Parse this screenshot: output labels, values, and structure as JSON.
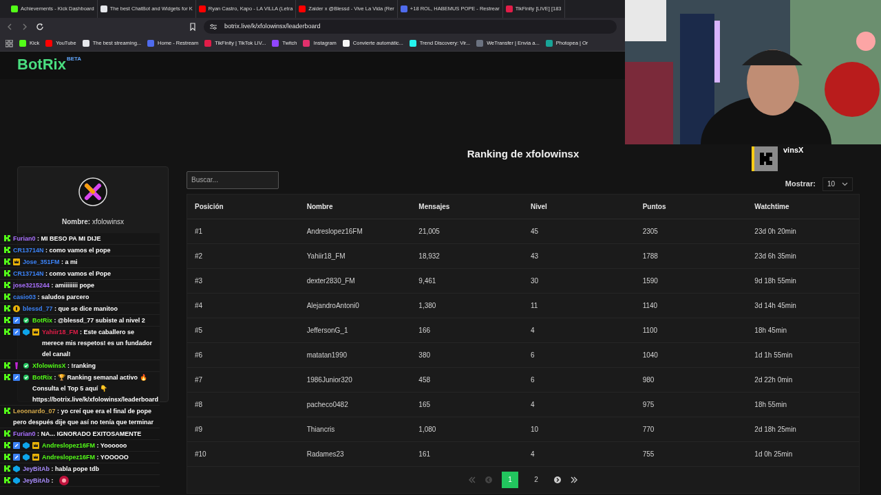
{
  "browser": {
    "tabs": [
      {
        "title": "Achievements - Kick Dashboard",
        "color": "#53fc18"
      },
      {
        "title": "The best ChatBot and Widgets for K",
        "color": "#e5e7eb"
      },
      {
        "title": "Ryan Castro, Kapo - LA VILLA (Letra",
        "color": "#ff0000"
      },
      {
        "title": "Zaider x @Blessd - Vive La Vida (Rer",
        "color": "#ff0000"
      },
      {
        "title": "+18 ROL, HABEMUS POPE - Restrear",
        "color": "#4f6bed"
      },
      {
        "title": "TikFinity [LIVE] [183",
        "color": "#e11d48"
      }
    ],
    "url": "botrix.live/k/xfolowinsx/leaderboard",
    "bookmarks": [
      {
        "label": "Kick",
        "color": "#53fc18"
      },
      {
        "label": "YouTube",
        "color": "#ff0000"
      },
      {
        "label": "The best streaming...",
        "color": "#e5e7eb"
      },
      {
        "label": "Home - Restream",
        "color": "#4f6bed"
      },
      {
        "label": "TikFinity | TikTok LIV...",
        "color": "#e11d48"
      },
      {
        "label": "Twitch",
        "color": "#9146ff"
      },
      {
        "label": "Instagram",
        "color": "#e1306c"
      },
      {
        "label": "Convierte automátic...",
        "color": "#f5f5f5"
      },
      {
        "label": "Trend Discovery: Vir...",
        "color": "#25f4ee"
      },
      {
        "label": "WeTransfer | Envía a...",
        "color": "#6b7280"
      },
      {
        "label": "Photopea | Or",
        "color": "#18a497"
      }
    ]
  },
  "header": {
    "logo": "BotRix",
    "badge": "BETA"
  },
  "profile": {
    "name_label": "Nombre:",
    "name": "xfolowinsx"
  },
  "ranking": {
    "title": "Ranking de xfolowinsx",
    "search_placeholder": "Buscar...",
    "show_label": "Mostrar:",
    "show_value": "10",
    "columns": [
      "Posición",
      "Nombre",
      "Mensajes",
      "Nivel",
      "Puntos",
      "Watchtime"
    ],
    "rows": [
      [
        "#1",
        "Andreslopez16FM",
        "21,005",
        "45",
        "2305",
        "23d 0h 20min"
      ],
      [
        "#2",
        "Yahiir18_FM",
        "18,932",
        "43",
        "1788",
        "23d 6h 35min"
      ],
      [
        "#3",
        "dexter2830_FM",
        "9,461",
        "30",
        "1590",
        "9d 18h 55min"
      ],
      [
        "#4",
        "AlejandroAntoni0",
        "1,380",
        "11",
        "1140",
        "3d 14h 45min"
      ],
      [
        "#5",
        "JeffersonG_1",
        "166",
        "4",
        "1100",
        "18h 45min"
      ],
      [
        "#6",
        "matatan1990",
        "380",
        "6",
        "1040",
        "1d 1h 55min"
      ],
      [
        "#7",
        "1986Junior320",
        "458",
        "6",
        "980",
        "2d 22h 0min"
      ],
      [
        "#8",
        "pacheco0482",
        "165",
        "4",
        "975",
        "18h 55min"
      ],
      [
        "#9",
        "Thiancris",
        "1,080",
        "10",
        "770",
        "2d 18h 25min"
      ],
      [
        "#10",
        "Radames23",
        "161",
        "4",
        "755",
        "1d 0h 25min"
      ]
    ],
    "pages": [
      {
        "label": "1",
        "selected": true
      },
      {
        "label": "2",
        "selected": false
      }
    ]
  },
  "alert": {
    "text": "vinsX"
  },
  "chat": [
    {
      "user": "Furian0",
      "color": "#a970ff",
      "text": ": MI BESO PA MI DIJE"
    },
    {
      "user": "CR13714N",
      "color": "#3b82f6",
      "text": ": como vamos el pope"
    },
    {
      "user": "Jose_351FM",
      "color": "#3b82f6",
      "badges": [
        {
          "kind": "crown"
        }
      ],
      "text": ": a mi"
    },
    {
      "user": "CR13714N",
      "color": "#3b82f6",
      "text": ": como vamos el Pope"
    },
    {
      "user": "jose3215244",
      "color": "#a970ff",
      "text": ": amiiiiiiii pope"
    },
    {
      "user": "casio03",
      "color": "#3b82f6",
      "text": ": saludos parcero"
    },
    {
      "user": "blessd_77",
      "color": "#3b82f6",
      "badges": [
        {
          "kind": "og"
        }
      ],
      "text": ": que se dice manitoo"
    },
    {
      "user": "BotRix",
      "color": "#53fc18",
      "badges": [
        {
          "kind": "mod"
        },
        {
          "kind": "verified"
        }
      ],
      "text": ": @blessd_77 subiste al nivel 2"
    },
    {
      "user": "Yahiir18_FM",
      "color": "#e11d48",
      "badges": [
        {
          "kind": "mod"
        },
        {
          "kind": "sub"
        },
        {
          "kind": "crown"
        }
      ],
      "text": ": Este caballero se merece mis respetos! es un fundador del canal!"
    },
    {
      "user": "XfolowinsX",
      "color": "#53fc18",
      "badges": [
        {
          "kind": "vip"
        },
        {
          "kind": "verified"
        }
      ],
      "text": ": !ranking"
    },
    {
      "user": "BotRix",
      "color": "#53fc18",
      "badges": [
        {
          "kind": "mod"
        },
        {
          "kind": "verified"
        }
      ],
      "text": ": 🏆 Ranking semanal activo 🔥 Consulta el Top 5 aquí 👇 https://botrix.live/k/xfolowinsx/leaderboard"
    },
    {
      "user": "Leoonardo_07",
      "color": "#d4a94a",
      "text": ": yo creí que era el final de pope pero después dije que así no tenía que terminar"
    },
    {
      "user": "Furian0",
      "color": "#a970ff",
      "text": ": NA... IGNORADO EXITOSAMENTE"
    },
    {
      "user": "Andreslopez16FM",
      "color": "#53fc18",
      "badges": [
        {
          "kind": "mod"
        },
        {
          "kind": "sub"
        },
        {
          "kind": "crown"
        }
      ],
      "text": ": Yoooooo"
    },
    {
      "user": "Andreslopez16FM",
      "color": "#53fc18",
      "badges": [
        {
          "kind": "mod"
        },
        {
          "kind": "sub"
        },
        {
          "kind": "crown"
        }
      ],
      "text": ": YOOOOO"
    },
    {
      "user": "JeyBitAb",
      "color": "#a78bfa",
      "badges": [
        {
          "kind": "sub"
        }
      ],
      "text": ": habla pope tdb"
    },
    {
      "user": "JeyBitAb",
      "color": "#a78bfa",
      "badges": [
        {
          "kind": "sub"
        }
      ],
      "text": ":",
      "kind": "emote"
    }
  ]
}
